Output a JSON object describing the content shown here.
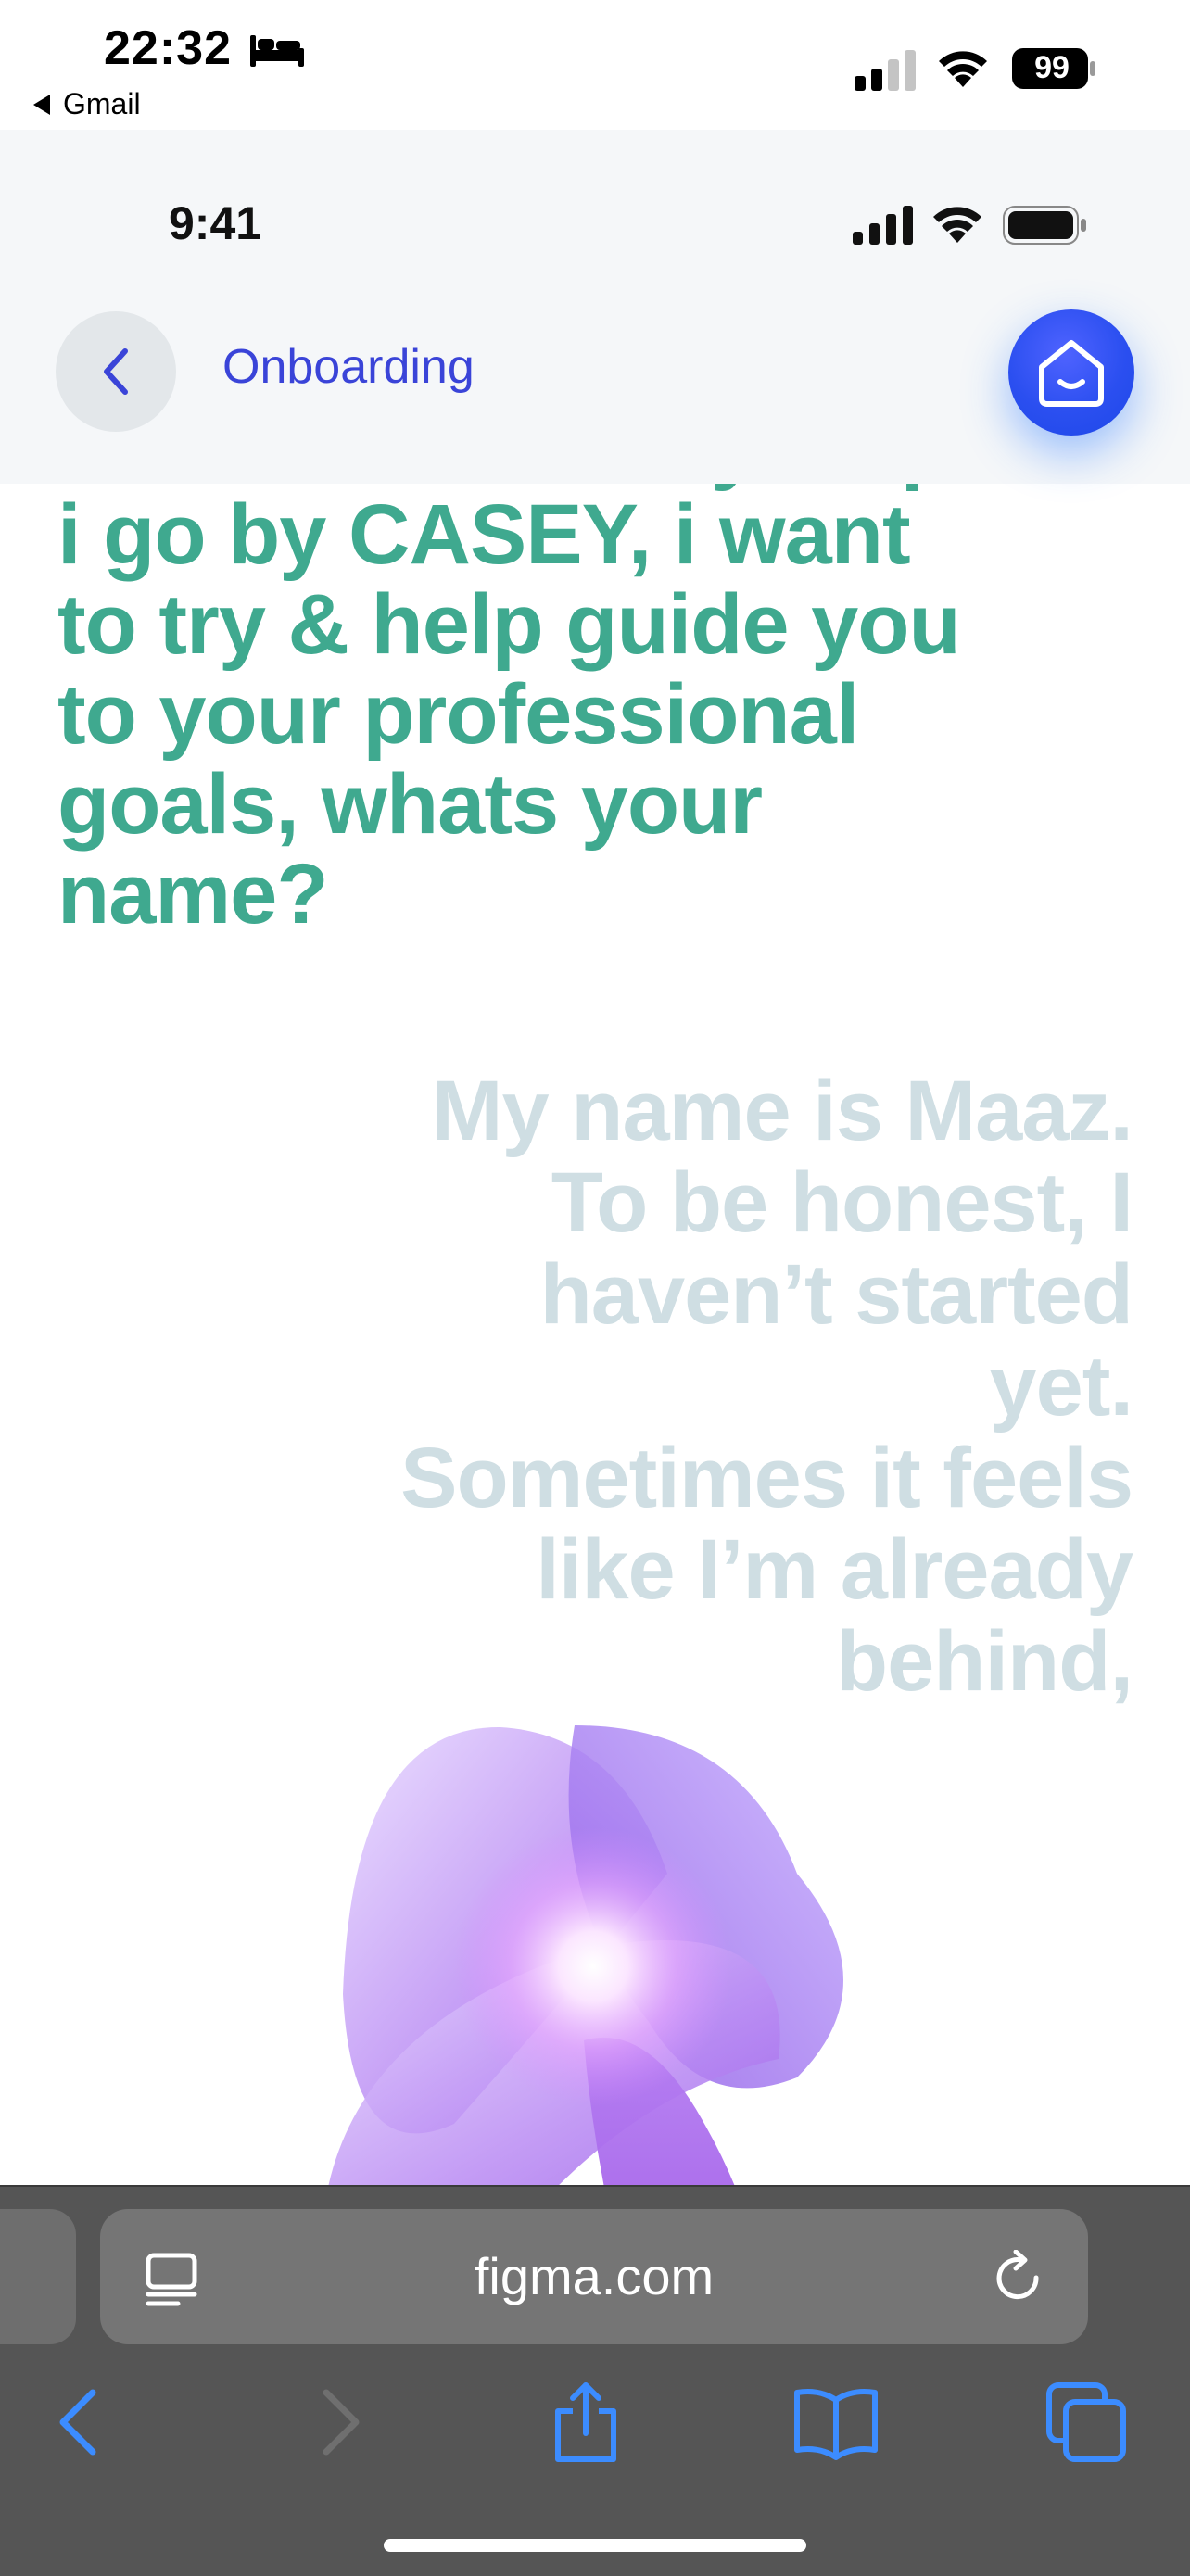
{
  "system_status": {
    "time": "22:32",
    "back_app": "Gmail",
    "battery": "99"
  },
  "prototype_status": {
    "time": "9:41"
  },
  "header": {
    "title": "Onboarding"
  },
  "conversation": {
    "bot_message": "chunks can really help. i go by CASEY, i want to try & help guide you to your professional goals, whats your name?",
    "user_message_lines": [
      "My name is Maaz.",
      "To be honest, I",
      "haven’t started",
      "yet.",
      "Sometimes it feels",
      "like I’m already",
      "behind,"
    ]
  },
  "browser": {
    "url": "figma.com"
  },
  "colors": {
    "accent_blue": "#3a44d8",
    "bot_text": "#3fa98f",
    "user_text": "#cfdee3",
    "toolbar_icon": "#3c8cff"
  }
}
